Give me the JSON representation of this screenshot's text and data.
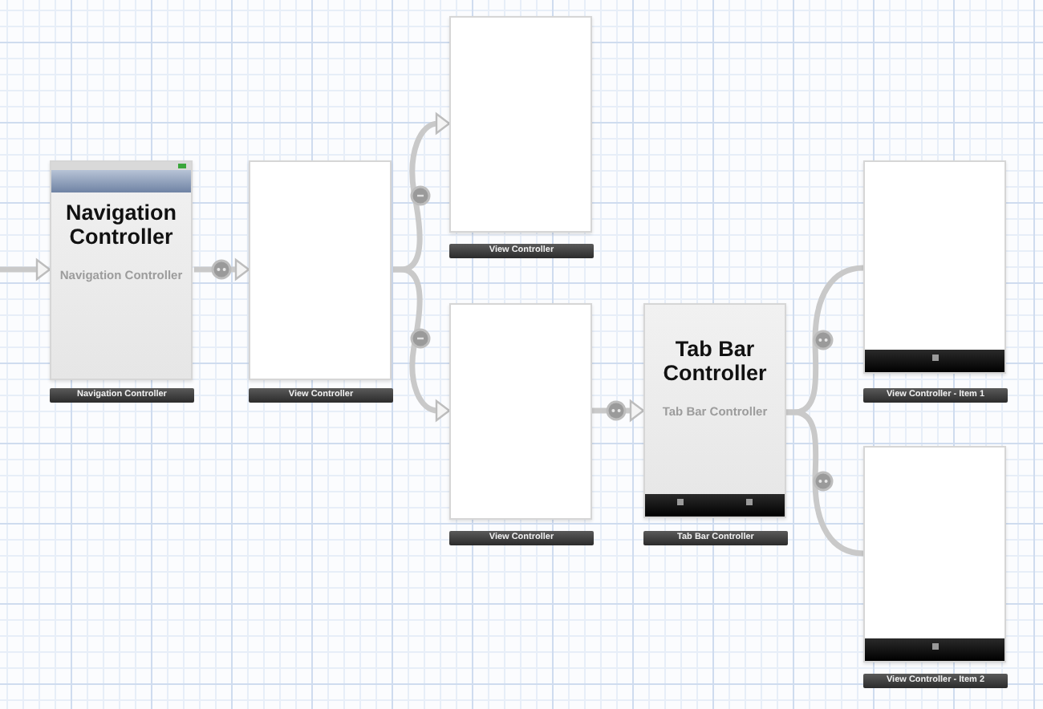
{
  "canvas": {
    "scenes": [
      {
        "kind": "navigation",
        "heading": "Navigation Controller",
        "placeholder_name": "Navigation Controller",
        "label": "Navigation Controller"
      },
      {
        "kind": "view",
        "label": "View Controller"
      },
      {
        "kind": "view",
        "label": "View Controller"
      },
      {
        "kind": "view",
        "label": "View Controller"
      },
      {
        "kind": "tab_bar",
        "heading": "Tab Bar Controller",
        "placeholder_name": "Tab Bar Controller",
        "label": "Tab Bar Controller",
        "tab_items": [
          {
            "kind": "item"
          },
          {
            "kind": "item"
          }
        ]
      },
      {
        "kind": "tab_item",
        "label": "View Controller - Item 1",
        "tab_items": [
          {
            "kind": "item"
          }
        ]
      },
      {
        "kind": "tab_item",
        "label": "View Controller - Item 2",
        "tab_items": [
          {
            "kind": "item"
          }
        ]
      }
    ],
    "segues": [
      {
        "kind": "initial"
      },
      {
        "kind": "relationship"
      },
      {
        "kind": "push"
      },
      {
        "kind": "push"
      },
      {
        "kind": "relationship"
      },
      {
        "kind": "relationship"
      },
      {
        "kind": "relationship"
      }
    ]
  }
}
